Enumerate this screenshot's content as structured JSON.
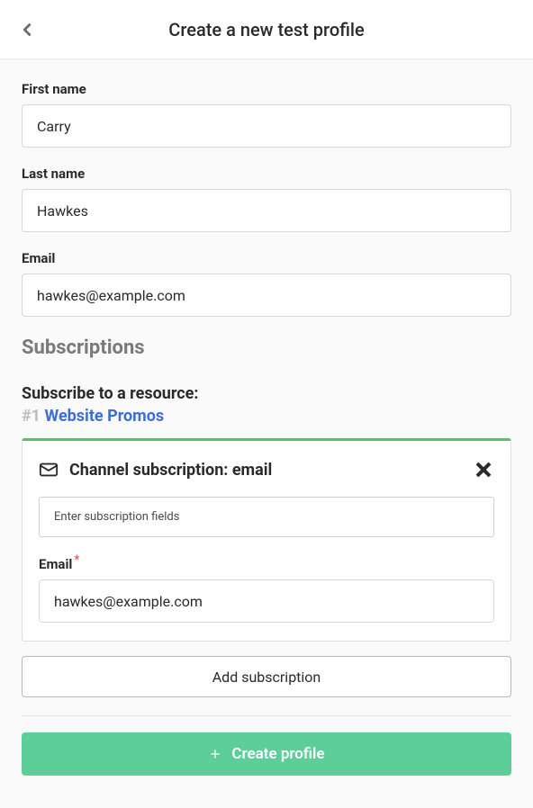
{
  "header": {
    "title": "Create a new test profile"
  },
  "fields": {
    "first_name": {
      "label": "First name",
      "value": "Carry"
    },
    "last_name": {
      "label": "Last name",
      "value": "Hawkes"
    },
    "email": {
      "label": "Email",
      "value": "hawkes@example.com"
    }
  },
  "subscriptions": {
    "section_title": "Subscriptions",
    "subscribe_label": "Subscribe to a resource:",
    "resource_index": "#1",
    "resource_name": "Website Promos",
    "card": {
      "title": "Channel subscription: email",
      "placeholder_text": "Enter subscription fields",
      "email_label": "Email",
      "email_value": "hawkes@example.com"
    },
    "add_button": "Add subscription"
  },
  "create_button": "Create profile"
}
